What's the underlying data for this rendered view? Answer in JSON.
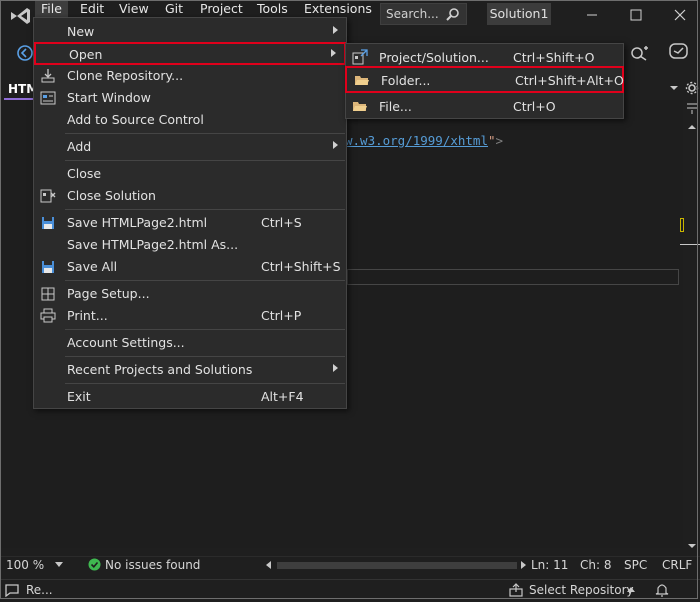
{
  "menubar": {
    "items": [
      "File",
      "Edit",
      "View",
      "Git",
      "Project",
      "Tools",
      "Extensions"
    ]
  },
  "search": {
    "label": "Search..."
  },
  "solution_badge": "Solution1",
  "editor_tab": {
    "label": "HTM"
  },
  "code": {
    "url": "w.w3.org/1999/xhtml",
    "quote": "\"",
    "bracket": ">"
  },
  "file_menu": {
    "items": [
      {
        "label": "New",
        "shortcut": "",
        "submenu": true
      },
      {
        "label": "Open",
        "shortcut": "",
        "submenu": true
      },
      {
        "label": "Clone Repository...",
        "shortcut": ""
      },
      {
        "label": "Start Window",
        "shortcut": ""
      },
      {
        "label": "Add to Source Control",
        "shortcut": ""
      },
      {
        "label": "Add",
        "shortcut": "",
        "submenu": true
      },
      {
        "label": "Close",
        "shortcut": ""
      },
      {
        "label": "Close Solution",
        "shortcut": ""
      },
      {
        "label": "Save HTMLPage2.html",
        "shortcut": "Ctrl+S"
      },
      {
        "label": "Save HTMLPage2.html As...",
        "shortcut": ""
      },
      {
        "label": "Save All",
        "shortcut": "Ctrl+Shift+S"
      },
      {
        "label": "Page Setup...",
        "shortcut": ""
      },
      {
        "label": "Print...",
        "shortcut": "Ctrl+P"
      },
      {
        "label": "Account Settings...",
        "shortcut": ""
      },
      {
        "label": "Recent Projects and Solutions",
        "shortcut": "",
        "submenu": true
      },
      {
        "label": "Exit",
        "shortcut": "Alt+F4"
      }
    ]
  },
  "open_submenu": {
    "items": [
      {
        "label": "Project/Solution...",
        "shortcut": "Ctrl+Shift+O"
      },
      {
        "label": "Folder...",
        "shortcut": "Ctrl+Shift+Alt+O"
      },
      {
        "label": "File...",
        "shortcut": "Ctrl+O"
      }
    ]
  },
  "status": {
    "zoom": "100 %",
    "issues": "No issues found",
    "line": "Ln: 11",
    "col": "Ch: 8",
    "spc": "SPC",
    "crlf": "CRLF"
  },
  "bottombar": {
    "left_label": "Re...",
    "select_repo": "Select Repository"
  },
  "colors": {
    "highlight": "#e0001b",
    "accent": "#8f6dd6",
    "ok": "#3fb950"
  }
}
